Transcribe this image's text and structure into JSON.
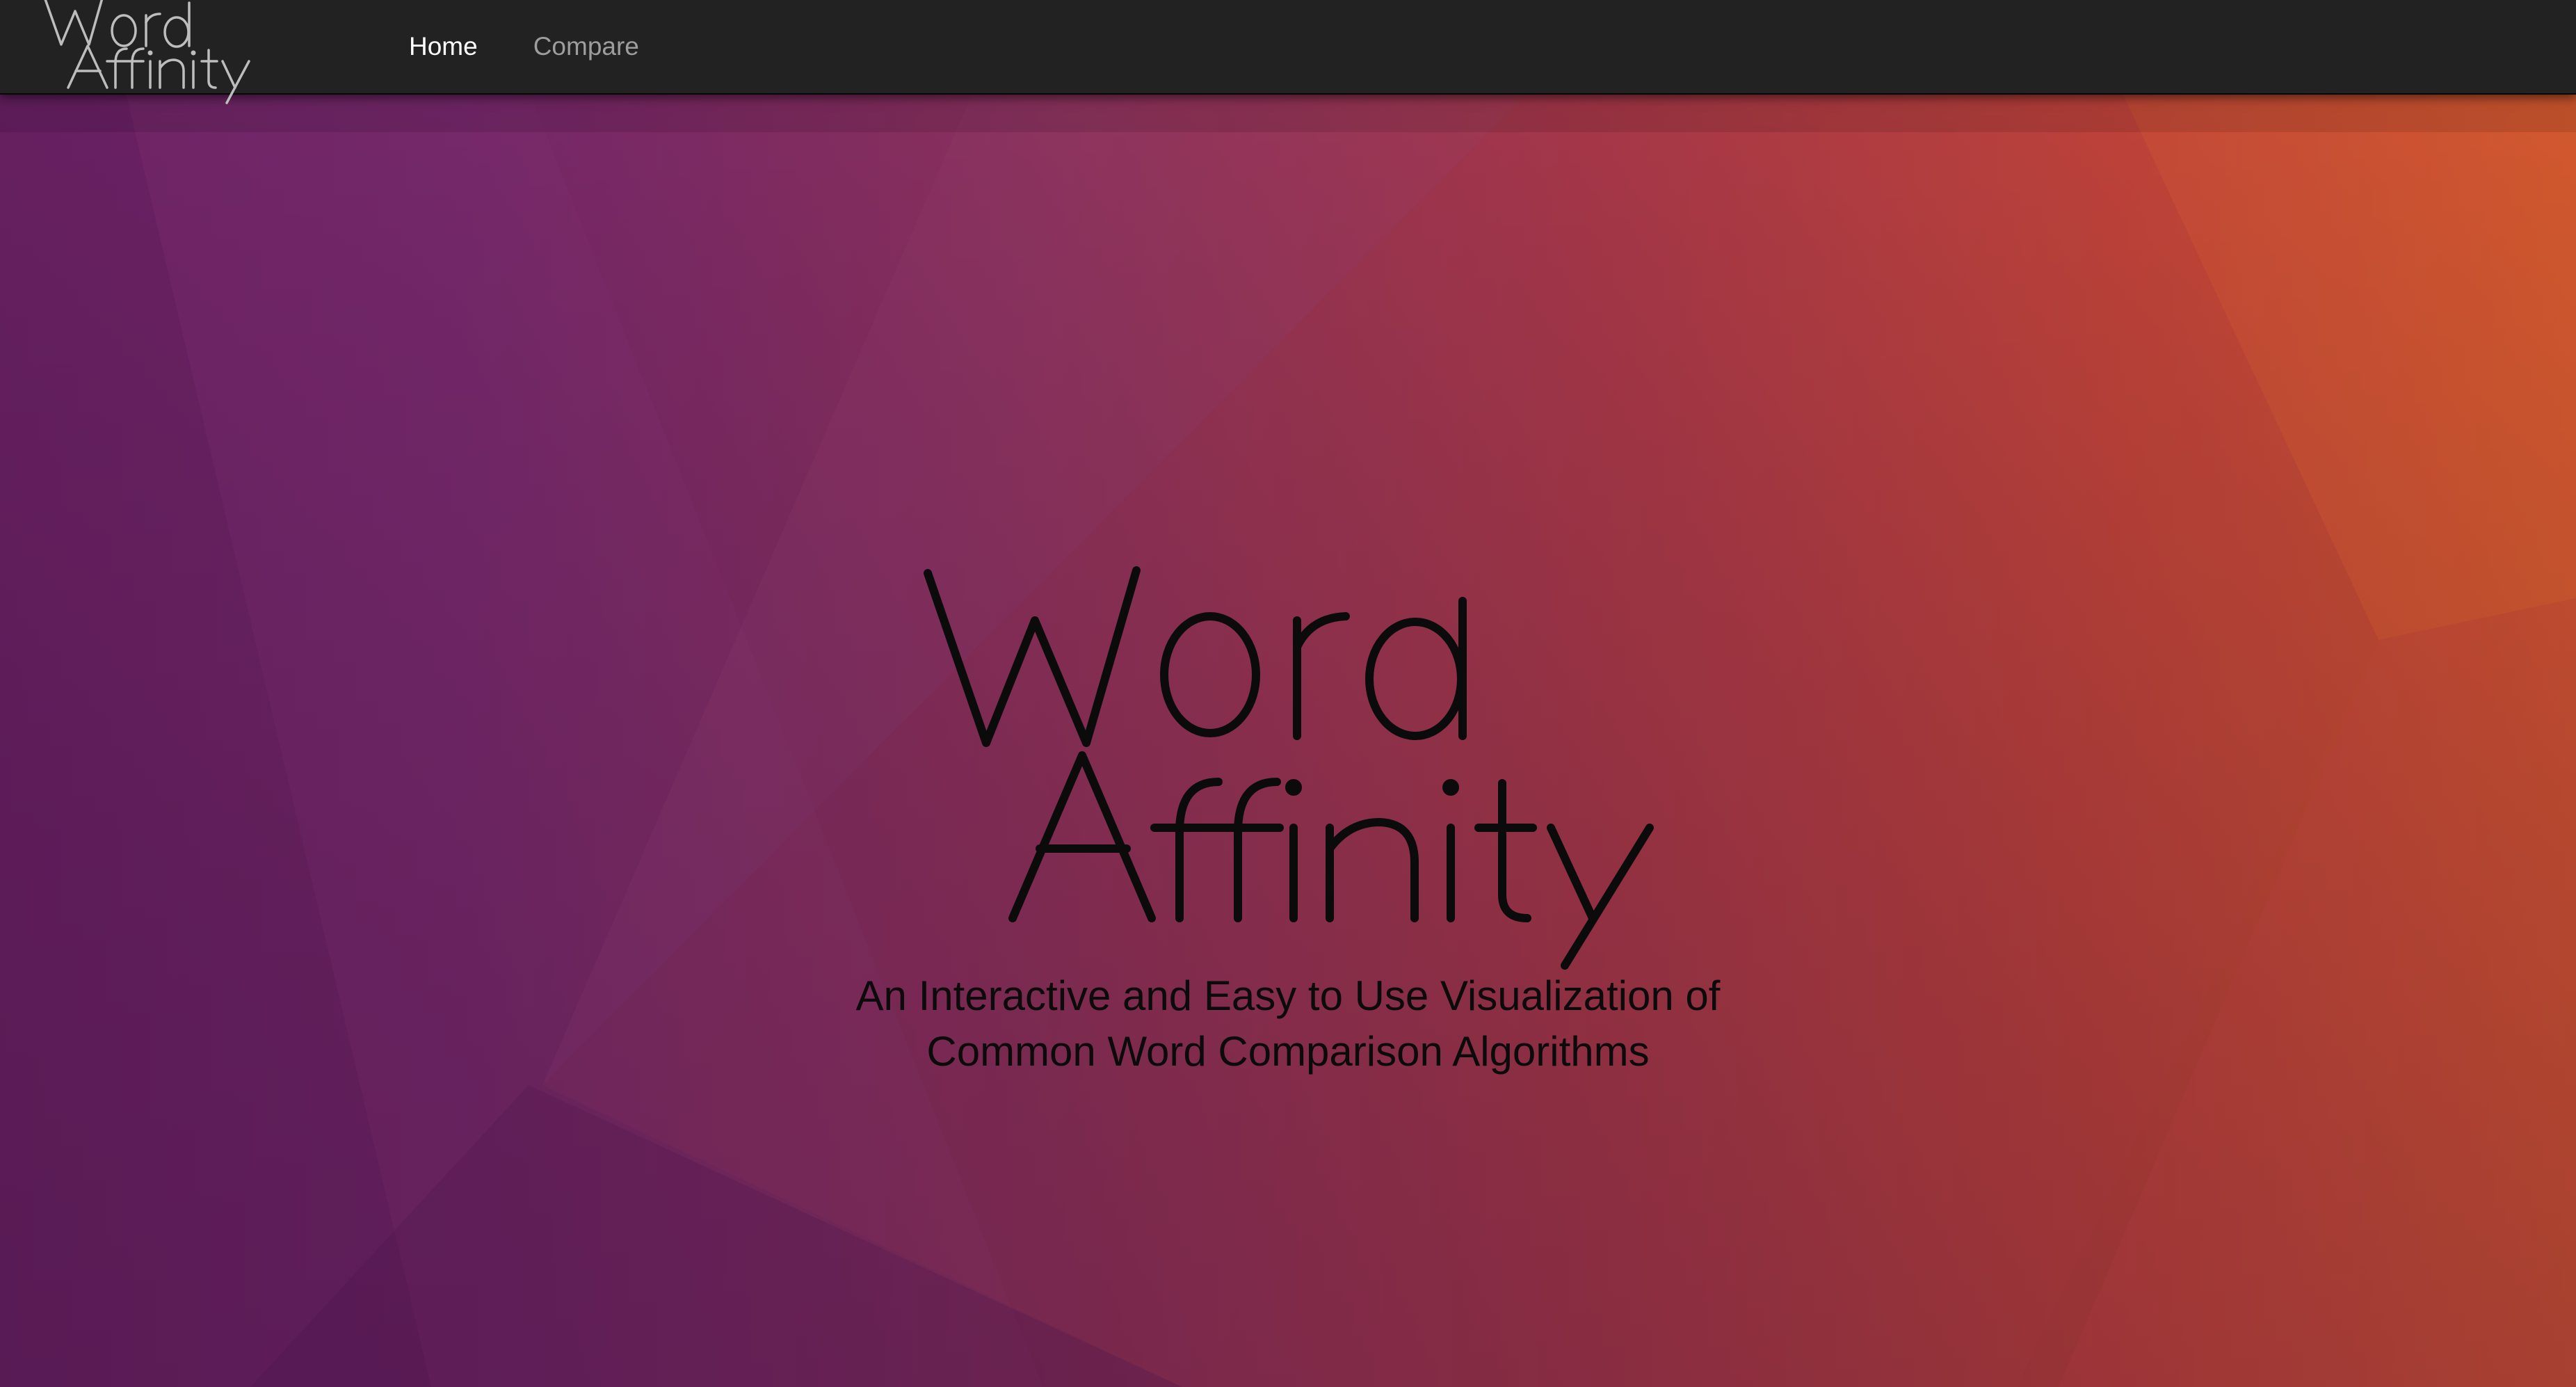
{
  "app": {
    "brand_line1": "Word",
    "brand_line2": "Affinity"
  },
  "nav": {
    "items": [
      {
        "label": "Home",
        "active": true
      },
      {
        "label": "Compare",
        "active": false
      }
    ]
  },
  "hero": {
    "logo_line1": "Word",
    "logo_line2": "Affinity",
    "tagline_line1": "An Interactive and Easy to Use Visualization of",
    "tagline_line2": "Common Word Comparison Algorithms"
  },
  "colors": {
    "navbar": "#222222",
    "nav_active": "#ffffff",
    "nav_inactive": "#9d9d9d",
    "gradient_left": "#6e2266",
    "gradient_mid": "#8f2f5a",
    "gradient_right": "#d2532e"
  }
}
